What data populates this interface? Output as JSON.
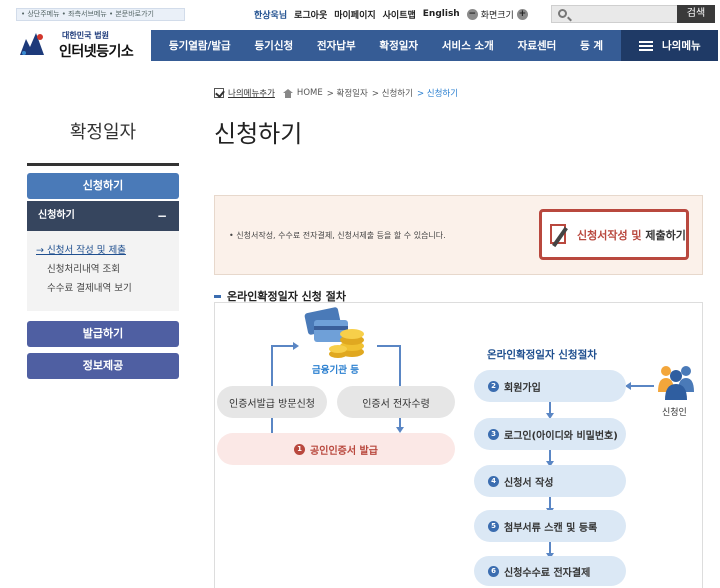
{
  "skip_links": "• 상단주메뉴 • 좌측서브메뉴 • 본문바로가기",
  "util": {
    "user": "한상욱님",
    "logout": "로그아웃",
    "mypage": "마이페이지",
    "sitemap": "사이트맵",
    "english": "English",
    "zoom_label": "화면크기",
    "zoom_minus": "−",
    "zoom_plus": "+"
  },
  "search": {
    "placeholder": "",
    "button": "검색"
  },
  "logo": {
    "sub": "대한민국 법원",
    "main": "인터넷등기소"
  },
  "nav": {
    "items": [
      "등기열람/발급",
      "등기신청",
      "전자납부",
      "확정일자",
      "서비스 소개",
      "자료센터",
      "등 계"
    ],
    "my_menu": "나의메뉴"
  },
  "lnb": {
    "title": "확정일자",
    "apply": "신청하기",
    "sub_open": "신청하기",
    "sub_toggle": "−",
    "sub_items": [
      "→ 신청서 작성 및 제출",
      "신청처리내역 조회",
      "수수료 결제내역 보기"
    ],
    "issue": "발급하기",
    "info": "정보제공"
  },
  "breadcrumb": {
    "favorite": "나의메뉴추가",
    "home": "HOME",
    "l1": "> 확정일자",
    "l2": "> 신청하기",
    "current": "> 신청하기"
  },
  "page_title": "신청하기",
  "info_box": {
    "text": "•  신청서작성, 수수료 전자결제, 신청서제출 등을 할 수 있습니다.",
    "button_red": "신청서작성 및",
    "button_dark": " 제출하기"
  },
  "section": {
    "title": "온라인확정일자 신청 절차",
    "bank": "금융기관 등",
    "visit": "인증서발급 방문신청",
    "receive": "인증서 전자수령",
    "cert_num": "1",
    "cert": "공인인증서 발급",
    "proc_title": "온라인확정일자 신청절차",
    "applicant": "신청인",
    "steps": [
      {
        "num": "2",
        "label": "회원가입"
      },
      {
        "num": "3",
        "label": "로그인(아이디와 비밀번호)"
      },
      {
        "num": "4",
        "label": "신청서 작성"
      },
      {
        "num": "5",
        "label": "첨부서류 스캔 및 등록"
      },
      {
        "num": "6",
        "label": "신청수수료 전자결제"
      }
    ]
  },
  "colors": {
    "nav": "#365c95",
    "my_menu": "#1f3a66",
    "accent_red": "#b9483e",
    "accent_blue": "#3b6db0"
  }
}
